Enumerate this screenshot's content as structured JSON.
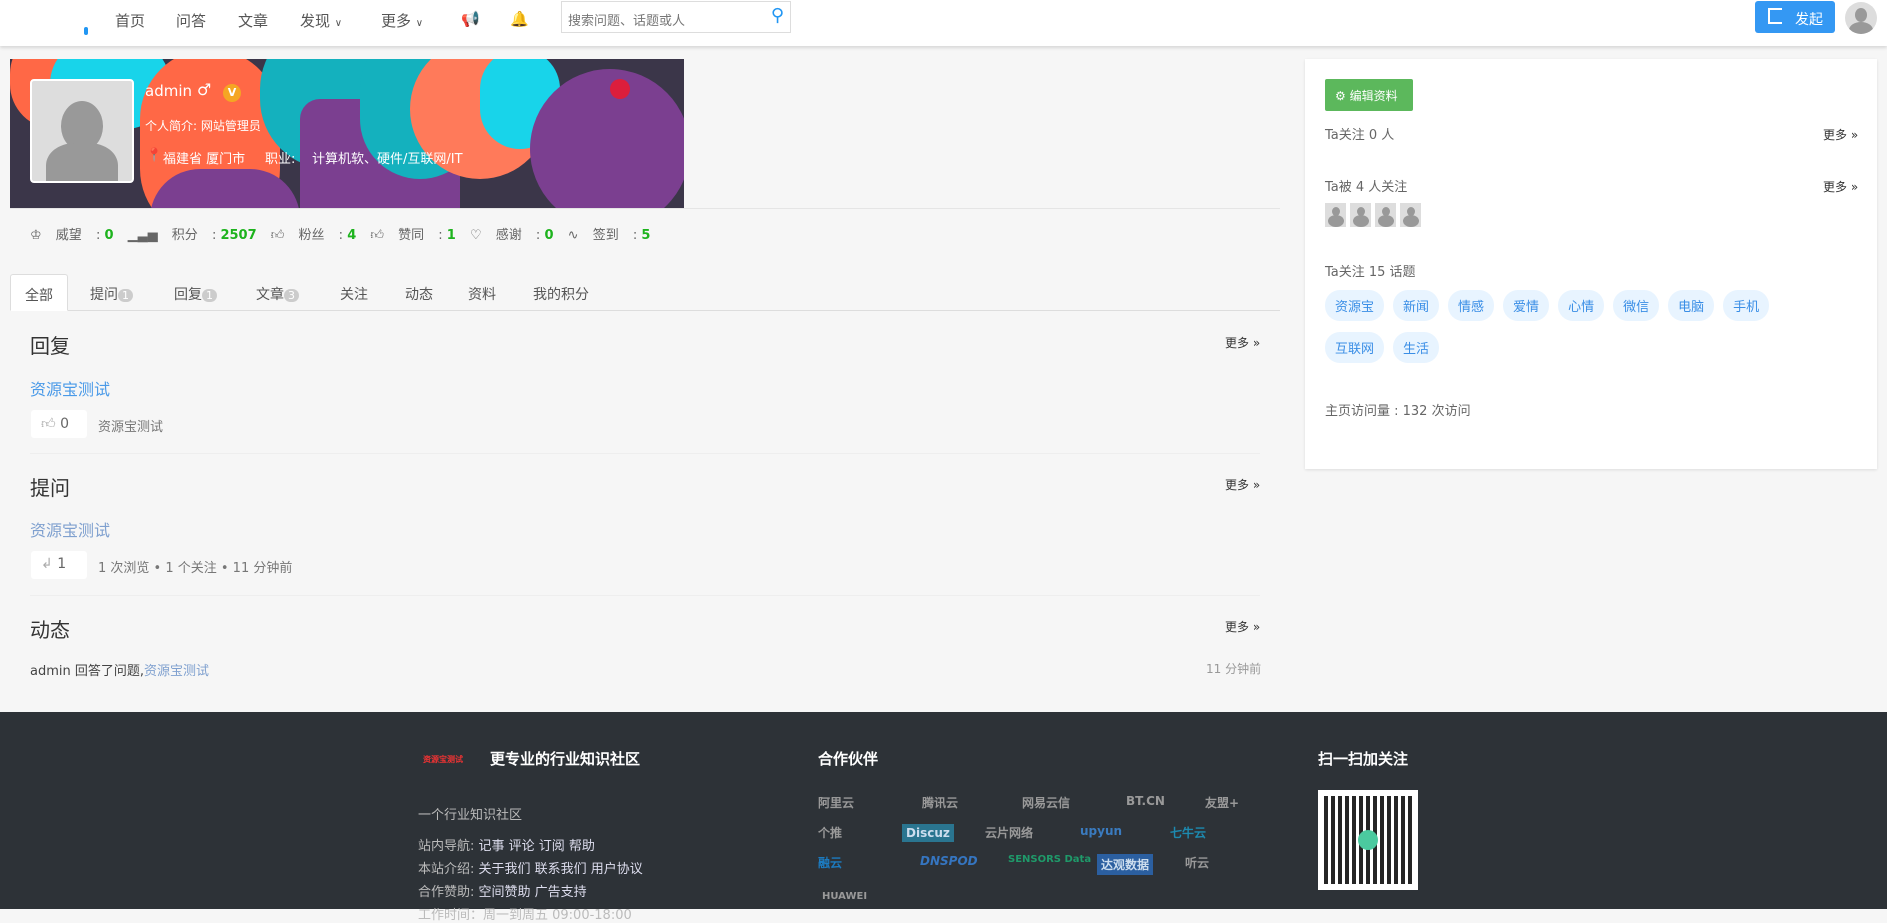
{
  "header": {
    "nav": [
      "首页",
      "问答",
      "文章",
      "发现",
      "更多"
    ],
    "search_placeholder": "搜索问题、话题或人",
    "publish": "发起"
  },
  "profile": {
    "name": "admin",
    "gender": "♂",
    "verified": "V",
    "intro": "个人简介: 网站管理员",
    "location": "福建省 厦门市",
    "job_label": "职业:",
    "job": "计算机软、硬件/互联网/IT"
  },
  "stats": [
    {
      "label": "威望",
      "value": "0",
      "icon": "crown-icon"
    },
    {
      "label": "积分",
      "value": "2507",
      "icon": "bar-chart-icon"
    },
    {
      "label": "粉丝",
      "value": "4",
      "icon": "thumb-icon"
    },
    {
      "label": "赞同",
      "value": "1",
      "icon": "thumb-icon"
    },
    {
      "label": "感谢",
      "value": "0",
      "icon": "heart-icon"
    },
    {
      "label": "签到",
      "value": "5",
      "icon": "pulse-icon"
    }
  ],
  "tabs": [
    {
      "label": "全部"
    },
    {
      "label": "提问",
      "count": "1"
    },
    {
      "label": "回复",
      "count": "1"
    },
    {
      "label": "文章",
      "count": "3"
    },
    {
      "label": "关注"
    },
    {
      "label": "动态"
    },
    {
      "label": "资料"
    },
    {
      "label": "我的积分"
    }
  ],
  "more": "更多 »",
  "reply": {
    "title": "回复",
    "link": "资源宝测试",
    "votes": "0",
    "excerpt": "资源宝测试"
  },
  "question": {
    "title": "提问",
    "link": "资源宝测试",
    "answers": "1",
    "meta": "1 次浏览 • 1 个关注 • 11 分钟前"
  },
  "activity": {
    "title": "动态",
    "user": "admin",
    "action": "回答了问题,",
    "link": "资源宝测试",
    "time": "11 分钟前"
  },
  "side": {
    "edit": "编辑资料",
    "following": "Ta关注 0 人",
    "followers": "Ta被 4 人关注",
    "topics_title": "Ta关注 15 话题",
    "topics": [
      "资源宝",
      "新闻",
      "情感",
      "爱情",
      "心情",
      "微信",
      "电脑",
      "手机",
      "互联网",
      "生活"
    ],
    "visits": "主页访问量 : 132 次访问"
  },
  "footer": {
    "logo_text": "资源宝测试",
    "slogan": "更专业的行业知识社区",
    "desc": "一个行业知识社区",
    "nav_label": "站内导航:",
    "nav_links": "记事 评论 订阅 帮助",
    "about_label": "本站介绍:",
    "about_links": "关于我们 联系我们 用户协议",
    "sponsor_label": "合作赞助:",
    "sponsor_links": "空间赞助 广告支持",
    "hours": "工作时间：周一到周五 09:00-18:00",
    "partners_title": "合作伙伴",
    "partners": [
      "阿里云",
      "腾讯云",
      "网易云信",
      "BT.CN",
      "友盟+",
      "个推",
      "Discuz",
      "云片网络",
      "upyun",
      "七牛云",
      "融云",
      "DNSPOD",
      "SENSORS Data",
      "达观数据",
      "听云",
      "HUAWEI"
    ],
    "qr_title": "扫一扫加关注"
  }
}
